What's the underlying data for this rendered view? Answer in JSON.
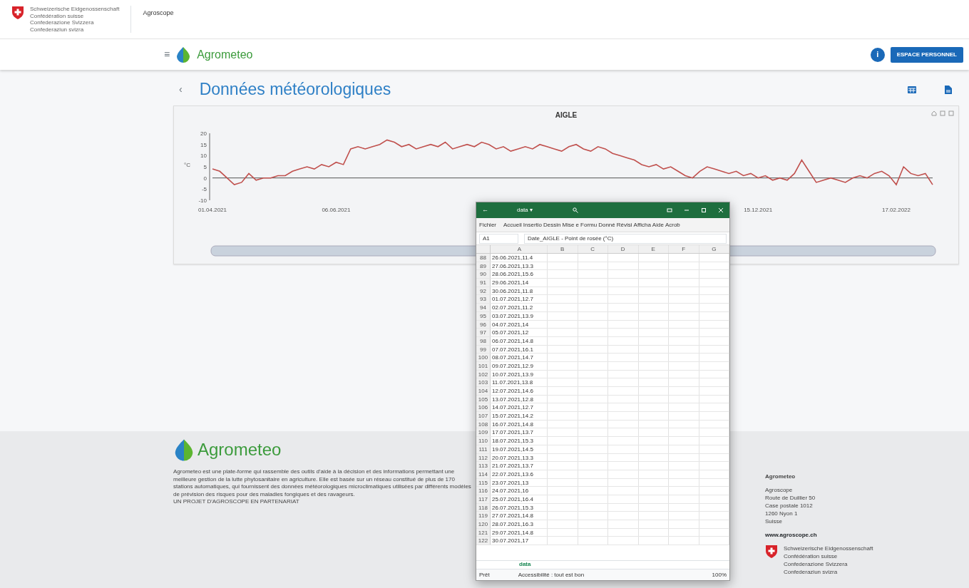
{
  "confederation": {
    "lines": [
      "Schweizerische Eidgenossenschaft",
      "Confédération suisse",
      "Confederazione Svizzera",
      "Confederaziun svizra"
    ],
    "office": "Agroscope"
  },
  "navbar": {
    "menu_icon": "≡",
    "brand": "Agrometeo",
    "info": "i",
    "account_button": "ESPACE PERSONNEL"
  },
  "page": {
    "back": "‹",
    "title": "Données météorologiques"
  },
  "chart": {
    "chart_data": {
      "type": "line",
      "title": "AIGLE",
      "ylabel": "°C",
      "ylim": [
        -10,
        20
      ],
      "yticks": [
        -10,
        -5,
        0,
        5,
        10,
        15,
        20
      ],
      "categories": [
        "01.04.2021",
        null,
        null,
        null,
        null,
        null,
        null,
        null,
        null,
        null,
        null,
        null,
        null,
        null,
        null,
        null,
        null,
        "06.06.2021",
        null,
        null,
        null,
        null,
        null,
        null,
        null,
        null,
        null,
        null,
        null,
        null,
        null,
        null,
        null,
        null,
        null,
        null,
        null,
        null,
        null,
        null,
        null,
        null,
        null,
        null,
        null,
        null,
        null,
        null,
        null,
        null,
        null,
        null,
        null,
        null,
        null,
        null,
        null,
        null,
        null,
        null,
        null,
        null,
        null,
        null,
        null,
        null,
        null,
        null,
        null,
        null,
        null,
        null,
        null,
        null,
        null,
        "15.12.2021",
        null,
        null,
        null,
        null,
        null,
        null,
        null,
        null,
        null,
        null,
        null,
        null,
        null,
        null,
        null,
        null,
        null,
        null,
        "17.02.2022",
        null,
        null,
        null,
        null,
        null
      ],
      "series": [
        {
          "color": "#c0504d",
          "values": [
            4,
            3,
            0,
            -3,
            -2,
            2,
            -1,
            0,
            0,
            1,
            1,
            3,
            4,
            5,
            4,
            6,
            5,
            7,
            6,
            13,
            14,
            13,
            14,
            15,
            17,
            16,
            14,
            15,
            13,
            14,
            15,
            14,
            16,
            13,
            14,
            15,
            14,
            16,
            15,
            13,
            14,
            12,
            13,
            14,
            13,
            15,
            14,
            13,
            12,
            14,
            15,
            13,
            12,
            14,
            13,
            11,
            10,
            9,
            8,
            6,
            5,
            6,
            4,
            5,
            3,
            1,
            0,
            3,
            5,
            4,
            3,
            2,
            3,
            1,
            2,
            0,
            1,
            -1,
            0,
            -1,
            2,
            8,
            3,
            -2,
            -1,
            0,
            -1,
            -2,
            0,
            1,
            0,
            2,
            3,
            1,
            -3,
            5,
            2,
            1,
            2,
            -3
          ]
        }
      ]
    }
  },
  "excel": {
    "back_icon": "←",
    "file": "data ▾",
    "menu": [
      "Fichier",
      "Accueil",
      "Insertio",
      "Dessin",
      "Mise e",
      "Formu",
      "Donné",
      "Révisi",
      "Afficha",
      "Aide",
      "Acrob"
    ],
    "cell_ref": "A1",
    "formula": "Date_AIGLE - Point de rosée (°C)",
    "columns": [
      "A",
      "B",
      "C",
      "D",
      "E",
      "F",
      "G"
    ],
    "rows": [
      {
        "num": "88",
        "value": "26.06.2021,11.4"
      },
      {
        "num": "89",
        "value": "27.06.2021,13.3"
      },
      {
        "num": "90",
        "value": "28.06.2021,15.6"
      },
      {
        "num": "91",
        "value": "29.06.2021,14"
      },
      {
        "num": "92",
        "value": "30.06.2021,11.8"
      },
      {
        "num": "93",
        "value": "01.07.2021,12.7"
      },
      {
        "num": "94",
        "value": "02.07.2021,11.2"
      },
      {
        "num": "95",
        "value": "03.07.2021,13.9"
      },
      {
        "num": "96",
        "value": "04.07.2021,14"
      },
      {
        "num": "97",
        "value": "05.07.2021,12"
      },
      {
        "num": "98",
        "value": "06.07.2021,14.8"
      },
      {
        "num": "99",
        "value": "07.07.2021,16.1"
      },
      {
        "num": "100",
        "value": "08.07.2021,14.7"
      },
      {
        "num": "101",
        "value": "09.07.2021,12.9"
      },
      {
        "num": "102",
        "value": "10.07.2021,13.9"
      },
      {
        "num": "103",
        "value": "11.07.2021,13.8"
      },
      {
        "num": "104",
        "value": "12.07.2021,14.6"
      },
      {
        "num": "105",
        "value": "13.07.2021,12.8"
      },
      {
        "num": "106",
        "value": "14.07.2021,12.7"
      },
      {
        "num": "107",
        "value": "15.07.2021,14.2"
      },
      {
        "num": "108",
        "value": "16.07.2021,14.8"
      },
      {
        "num": "109",
        "value": "17.07.2021,13.7"
      },
      {
        "num": "110",
        "value": "18.07.2021,15.3"
      },
      {
        "num": "111",
        "value": "19.07.2021,14.5"
      },
      {
        "num": "112",
        "value": "20.07.2021,13.3"
      },
      {
        "num": "113",
        "value": "21.07.2021,13.7"
      },
      {
        "num": "114",
        "value": "22.07.2021,13.6"
      },
      {
        "num": "115",
        "value": "23.07.2021,13"
      },
      {
        "num": "116",
        "value": "24.07.2021,16"
      },
      {
        "num": "117",
        "value": "25.07.2021,16.4"
      },
      {
        "num": "118",
        "value": "26.07.2021,15.3"
      },
      {
        "num": "119",
        "value": "27.07.2021,14.8"
      },
      {
        "num": "120",
        "value": "28.07.2021,16.3"
      },
      {
        "num": "121",
        "value": "29.07.2021,14.8"
      },
      {
        "num": "122",
        "value": "30.07.2021,17"
      }
    ],
    "sheet_tab": "data",
    "status": "Prêt",
    "accessibility": "Accessibilité : tout est bon",
    "zoom": "100%"
  },
  "footer": {
    "brand": "Agrometeo",
    "description": "Agrometeo est une plate-forme qui rassemble des outils d'aide à la décision et des informations permettant une meilleure gestion de la lutte phytosanitaire en agriculture. Elle est basée sur un réseau constitué de plus de 170 stations automatiques, qui fournissent des données météorologiques microclimatiques utilisées par différents modèles de prévision des risques pour des maladies fongiques et des ravageurs.",
    "partnership": "UN PROJET D'AGROSCOPE EN PARTENARIAT",
    "contact_title": "Agrometeo",
    "address": [
      "Agroscope",
      "Route de Duillier 50",
      "Case postale 1012",
      "1260 Nyon 1",
      "Suisse"
    ],
    "website": "www.agroscope.ch",
    "confederation": [
      "Schweizerische Eidgenossenschaft",
      "Confédération suisse",
      "Confederazione Svizzera",
      "Confederaziun svizra"
    ]
  }
}
